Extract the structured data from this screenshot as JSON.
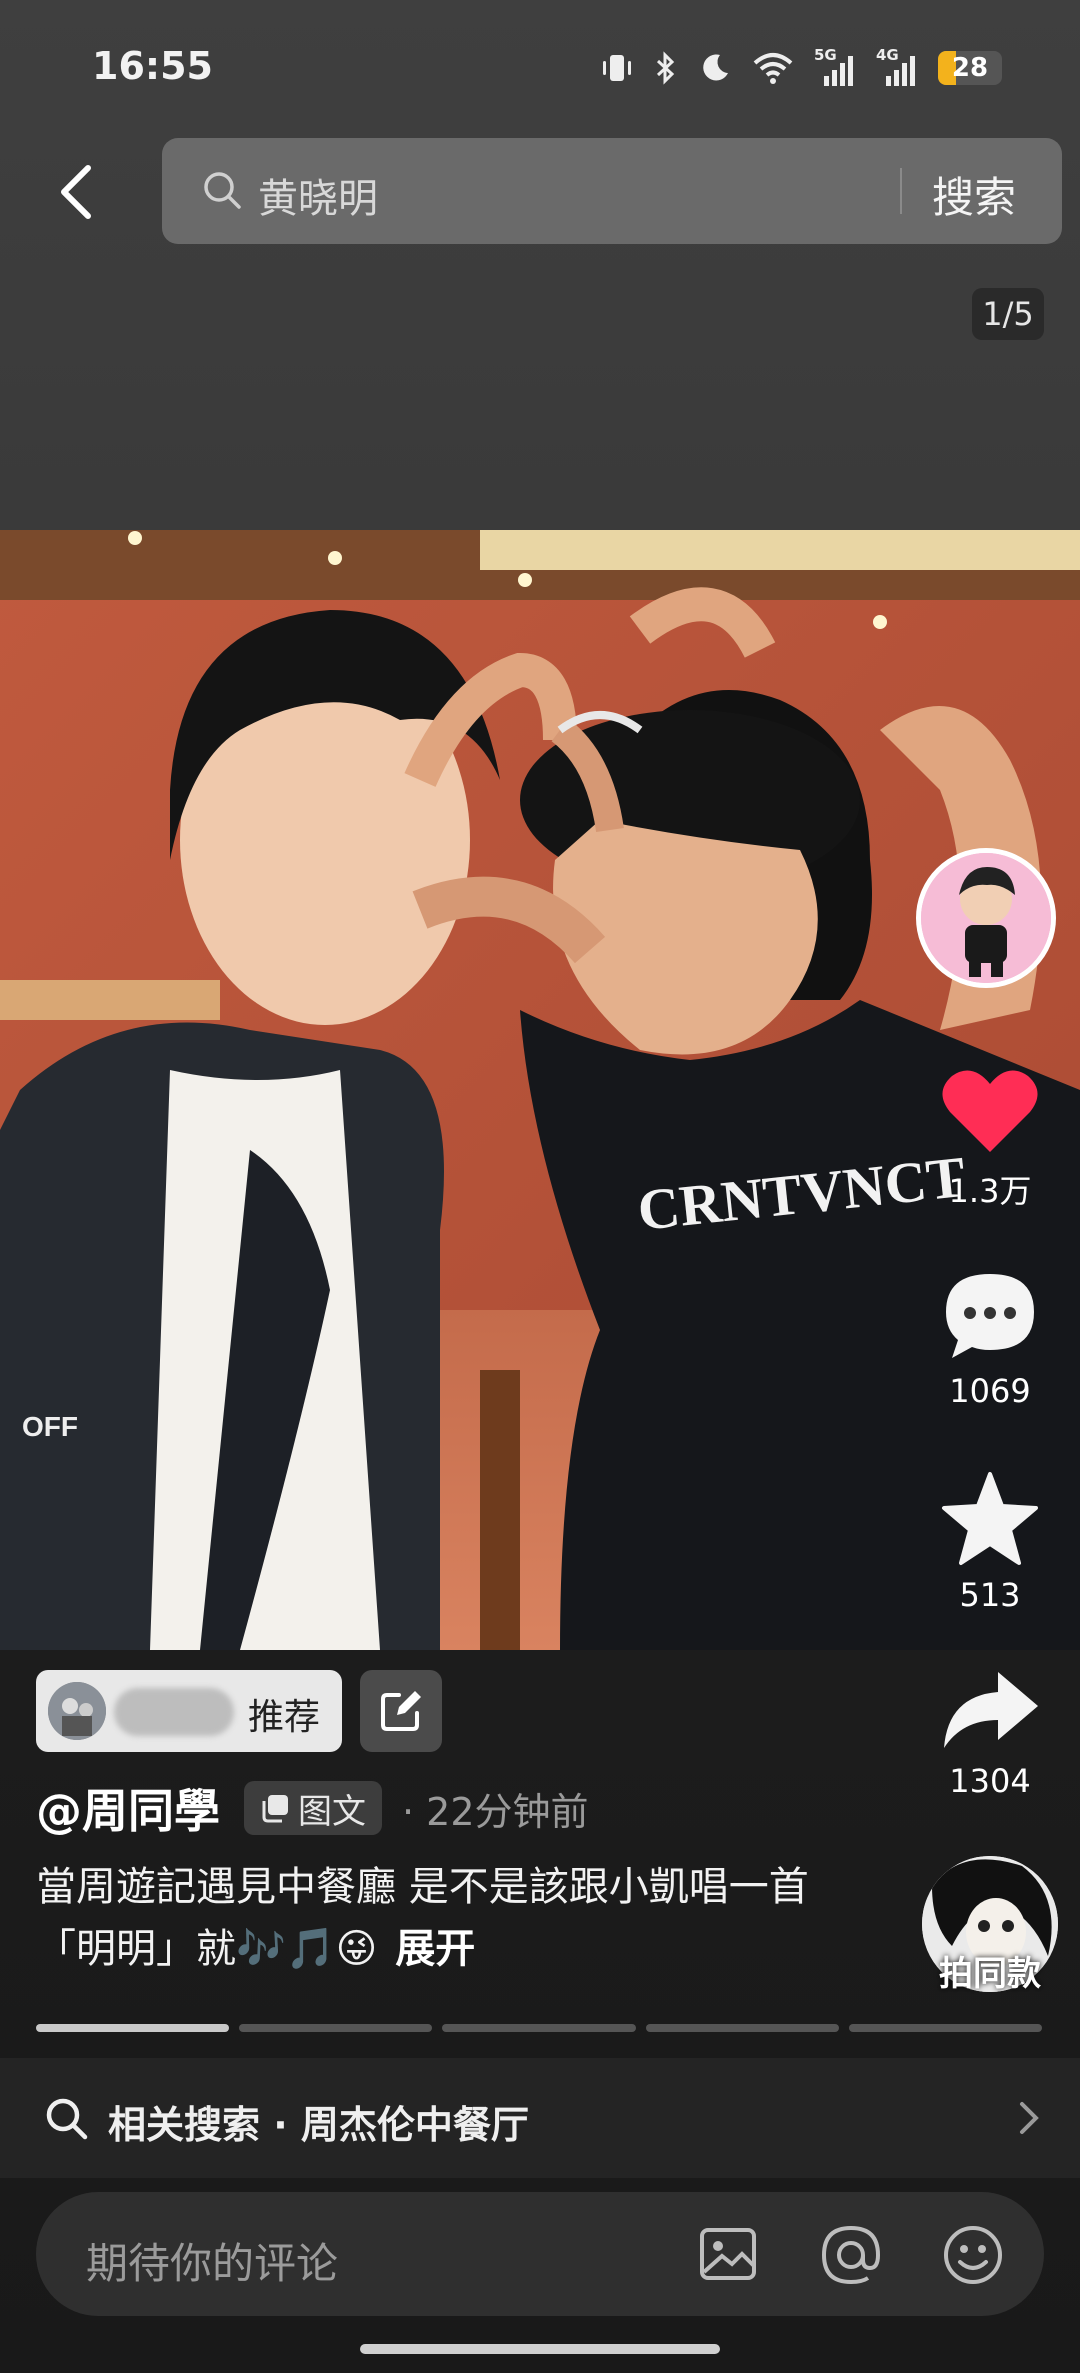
{
  "status_bar": {
    "time": "16:55",
    "network_1": "5G",
    "network_2": "4G",
    "battery_level": "28",
    "battery_fraction": 0.28,
    "icons": [
      "vibrate-icon",
      "bluetooth-icon",
      "moon-icon",
      "wifi-icon",
      "signal-5g-icon",
      "signal-4g-icon",
      "battery-icon"
    ]
  },
  "header": {
    "search_query": "黄晓明",
    "search_button": "搜索",
    "page_counter": "1/5"
  },
  "actions": {
    "likes": "1.3万",
    "comments": "1069",
    "favorites": "513",
    "shares": "1304",
    "like_color": "#ff2d55"
  },
  "post": {
    "recommend_label": "推荐",
    "author": "@周同學",
    "type_label": "图文",
    "time_ago": "· 22分钟前",
    "caption": "當周遊記遇見中餐廳 是不是該跟小凱唱一首「明明」就🎶🎵😜",
    "expand": "展开",
    "same_style": "拍同款"
  },
  "progress": {
    "segments": 5,
    "active_index": 0
  },
  "related_search": {
    "text": "相关搜索 · 周杰伦中餐厅"
  },
  "comment_bar": {
    "placeholder": "期待你的评论"
  }
}
